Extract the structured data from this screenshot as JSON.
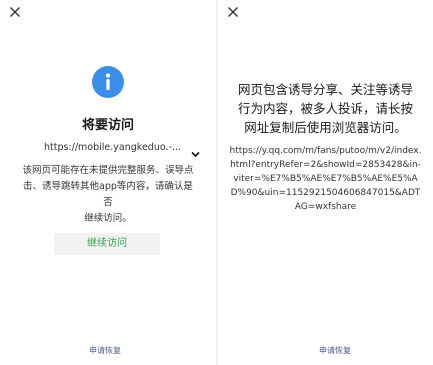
{
  "left": {
    "title": "将要访问",
    "url": "https://mobile.yangkeduo.-...",
    "description_lines": [
      "该网页可能存在未提供完整服务、误导点",
      "击、诱导跳转其他app等内容，请确认是否",
      "继续访问。"
    ],
    "continue_label": "继续访问",
    "footer_link": "申请恢复"
  },
  "right": {
    "warning_lines": [
      "网页包含诱导分享、关注等诱导",
      "行为内容，被多人投诉，请长按",
      "网址复制后使用浏览器访问。"
    ],
    "url_lines": [
      "https://y.qq.com/m/fans/putoo/m/v2/index.",
      "html?entryRefer=2&showId=2853428&in-",
      "viter=%E7%B5%AE%E7%B5%AE%E5%A",
      "D%90&uin=1152921504606847015&ADT",
      "AG=wxfshare"
    ],
    "footer_link": "申请恢复"
  },
  "icons": {
    "close": "close-icon",
    "info": "info-icon",
    "chevron": "chevron-down-icon"
  },
  "colors": {
    "info_blue": "#3d8ee6",
    "continue_green": "#2fa84f",
    "link_blue": "#4a5a8c"
  }
}
